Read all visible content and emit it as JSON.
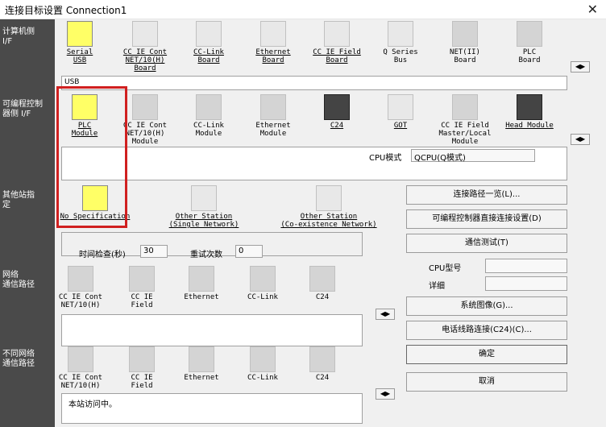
{
  "window": {
    "title": "连接目标设置 Connection1",
    "close_glyph": "✕"
  },
  "sidebar": {
    "pc_if": "计算机侧\nI/F",
    "plc_if": "可编程控制\n器侧 I/F",
    "other_station": "其他站指\n定",
    "network_route": "网络\n通信路径",
    "diff_network": "不同网络\n通信路径"
  },
  "pc_if": {
    "items": [
      {
        "label": "Serial\nUSB",
        "link": true
      },
      {
        "label": "CC IE Cont\nNET/10(H)\nBoard",
        "link": true
      },
      {
        "label": "CC-Link\nBoard",
        "link": true
      },
      {
        "label": "Ethernet\nBoard",
        "link": true
      },
      {
        "label": "CC IE Field\nBoard",
        "link": true
      },
      {
        "label": "Q Series\nBus",
        "link": false
      },
      {
        "label": "NET(II)\nBoard",
        "link": false
      },
      {
        "label": "PLC\nBoard",
        "link": false
      }
    ],
    "status": "USB"
  },
  "plc_if": {
    "items": [
      {
        "label": "PLC\nModule",
        "link": true
      },
      {
        "label": "CC IE Cont\nNET/10(H)\nModule",
        "link": false
      },
      {
        "label": "CC-Link\nModule",
        "link": false
      },
      {
        "label": "Ethernet\nModule",
        "link": false
      },
      {
        "label": "C24",
        "link": true
      },
      {
        "label": "GOT",
        "link": true
      },
      {
        "label": "CC IE Field\nMaster/Local\nModule",
        "link": false
      },
      {
        "label": "Head Module",
        "link": true
      }
    ],
    "cpu_mode_label": "CPU模式",
    "cpu_mode_value": "QCPU(Q模式)"
  },
  "other_station": {
    "items": [
      {
        "label": "No Specification",
        "link": true
      },
      {
        "label": "Other Station\n(Single Network)",
        "link": true
      },
      {
        "label": "Other Station\n(Co-existence Network)",
        "link": true
      }
    ],
    "time_check_label": "时间检查(秒)",
    "time_check_value": "30",
    "retry_label": "重试次数",
    "retry_value": "0"
  },
  "network_route": {
    "items": [
      {
        "label": "CC IE Cont\nNET/10(H)"
      },
      {
        "label": "CC IE\nField"
      },
      {
        "label": "Ethernet"
      },
      {
        "label": "CC-Link"
      },
      {
        "label": "C24"
      }
    ]
  },
  "diff_network": {
    "items": [
      {
        "label": "CC IE Cont\nNET/10(H)"
      },
      {
        "label": "CC IE\nField"
      },
      {
        "label": "Ethernet"
      },
      {
        "label": "CC-Link"
      },
      {
        "label": "C24"
      }
    ],
    "status": "本站访问中。"
  },
  "buttons": {
    "route_list": "连接路径一览(L)...",
    "direct_connect": "可编程控制器直接连接设置(D)",
    "comm_test": "通信测试(T)",
    "system_image": "系统图像(G)...",
    "phone_connect": "电话线路连接(C24)(C)...",
    "ok": "确定",
    "cancel": "取消"
  },
  "cpu_info": {
    "model_label": "CPU型号",
    "detail_label": "详细"
  },
  "scroll_glyphs": "◀▶"
}
